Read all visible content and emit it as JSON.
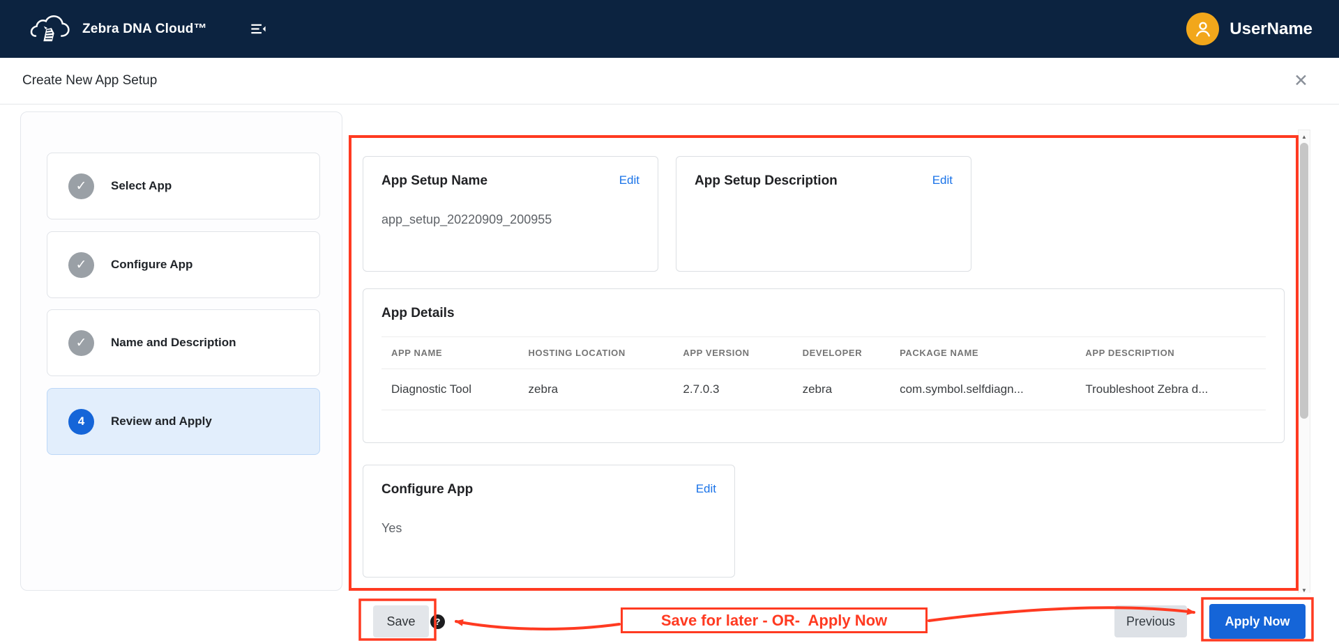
{
  "colors": {
    "navbar_bg": "#0c2340",
    "primary_blue": "#1565d8",
    "link_blue": "#1a73e8",
    "avatar_orange": "#f2a71b",
    "annotation_red": "#ff3a21",
    "step_done_gray": "#9aa0a6",
    "active_step_bg": "#e2eefc"
  },
  "navbar": {
    "brand": "Zebra DNA Cloud™",
    "username": "UserName",
    "icons": {
      "logo": "zebra-cloud-logo",
      "menu": "collapse-menu-icon",
      "avatar": "user-avatar-icon"
    }
  },
  "titlebar": {
    "title": "Create New App Setup",
    "close_glyph": "✕"
  },
  "stepper": {
    "steps": [
      {
        "label": "Select App",
        "state": "done",
        "glyph": "✓"
      },
      {
        "label": "Configure App",
        "state": "done",
        "glyph": "✓"
      },
      {
        "label": "Name and Description",
        "state": "done",
        "glyph": "✓"
      },
      {
        "label": "Review and Apply",
        "state": "active",
        "glyph": "4"
      }
    ]
  },
  "review": {
    "name_card": {
      "title": "App Setup Name",
      "edit_label": "Edit",
      "value": "app_setup_20220909_200955"
    },
    "description_card": {
      "title": "App Setup Description",
      "edit_label": "Edit",
      "value": ""
    },
    "details_card": {
      "title": "App Details",
      "columns": [
        "APP NAME",
        "HOSTING LOCATION",
        "APP VERSION",
        "DEVELOPER",
        "PACKAGE NAME",
        "APP DESCRIPTION"
      ],
      "row": [
        "Diagnostic Tool",
        "zebra",
        "2.7.0.3",
        "zebra",
        "com.symbol.selfdiagn...",
        "Troubleshoot Zebra d..."
      ]
    },
    "configure_card": {
      "title": "Configure App",
      "edit_label": "Edit",
      "value": "Yes"
    }
  },
  "footer": {
    "save_label": "Save",
    "help_glyph": "?",
    "previous_label": "Previous",
    "apply_label": "Apply Now"
  },
  "annotations": {
    "callout_text": "Save for later - OR-  Apply Now"
  },
  "scrollbar": {
    "up_glyph": "▲",
    "down_glyph": "▼"
  }
}
